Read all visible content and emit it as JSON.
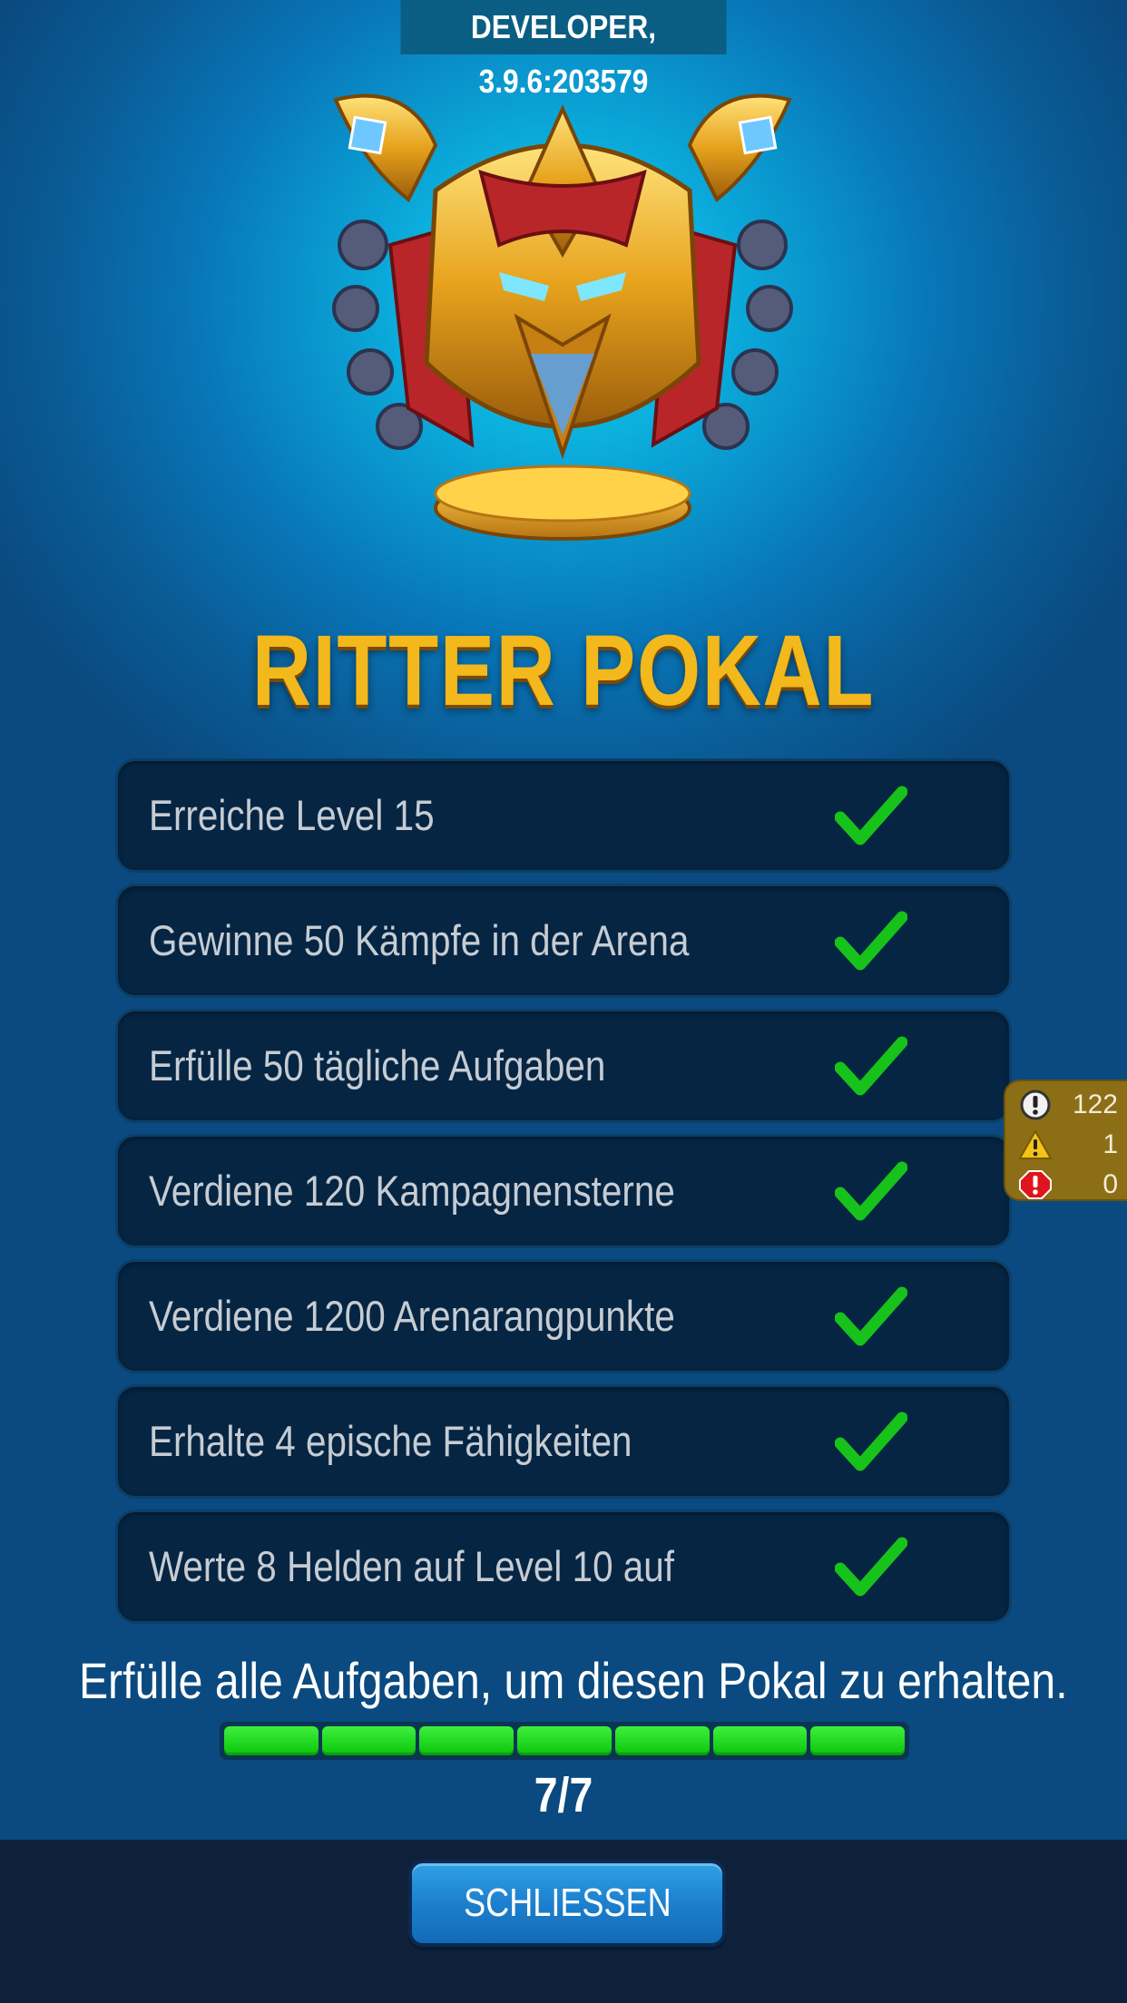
{
  "build_info": "DEVELOPER, 3.9.6:203579",
  "trophy": {
    "title": "RITTER POKAL",
    "icon": "knight-trophy-icon"
  },
  "tasks": [
    {
      "label": "Erreiche Level 15",
      "completed": true
    },
    {
      "label": "Gewinne 50 Kämpfe in der Arena",
      "completed": true
    },
    {
      "label": "Erfülle 50 tägliche Aufgaben",
      "completed": true
    },
    {
      "label": "Verdiene 120 Kampagnensterne",
      "completed": true
    },
    {
      "label": "Verdiene 1200 Arenarangpunkte",
      "completed": true
    },
    {
      "label": "Erhalte 4 epische Fähigkeiten",
      "completed": true
    },
    {
      "label": "Werte 8 Helden auf Level 10 auf",
      "completed": true
    }
  ],
  "hint": "Erfülle alle Aufgaben, um diesen Pokal zu erhalten.",
  "progress": {
    "completed": 7,
    "total": 7,
    "text": "7/7"
  },
  "close_button": "SCHLIESSEN",
  "debug_counters": [
    {
      "icon": "info-circle-icon",
      "count": "122"
    },
    {
      "icon": "warning-triangle-icon",
      "count": "1"
    },
    {
      "icon": "error-octagon-icon",
      "count": "0"
    }
  ],
  "colors": {
    "title_gold": "#f2b81c",
    "check_green": "#17c21a",
    "task_bg": "#052543",
    "button_blue": "#1b7dcc"
  }
}
